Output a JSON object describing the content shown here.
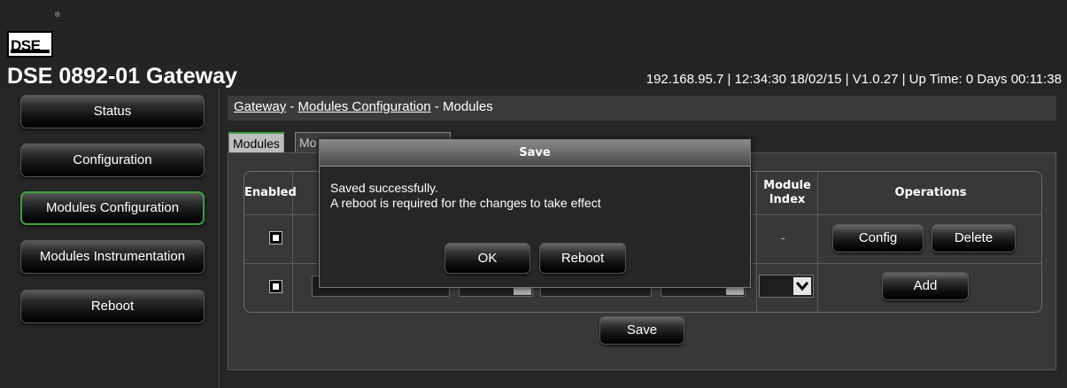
{
  "header": {
    "logo_text": "DSE",
    "logo_mark": "®",
    "title": "DSE 0892-01 Gateway",
    "status_line": "192.168.95.7 | 12:34:30 18/02/15 | V1.0.27 | Up Time: 0 Days 00:11:38"
  },
  "sidebar": {
    "items": [
      {
        "label": "Status"
      },
      {
        "label": "Configuration"
      },
      {
        "label": "Modules Configuration",
        "active": true
      },
      {
        "label": "Modules Instrumentation"
      },
      {
        "label": "Reboot"
      }
    ]
  },
  "breadcrumb": {
    "part1": "Gateway",
    "sep1": " - ",
    "part2": "Modules Configuration",
    "sep2": " - ",
    "part3": "Modules"
  },
  "tabs": [
    {
      "label": "Modules",
      "active": true
    },
    {
      "label": "Mo"
    }
  ],
  "table": {
    "headers": {
      "enabled": "Enabled",
      "module_index": "Module Index",
      "operations": "Operations"
    },
    "rows": [
      {
        "enabled": true,
        "module_index": "-",
        "buttons": [
          "Config",
          "Delete"
        ]
      },
      {
        "enabled": true,
        "module_index": "",
        "buttons": [
          "Add"
        ]
      }
    ]
  },
  "save_label": "Save",
  "modal": {
    "title": "Save",
    "line1": "Saved successfully.",
    "line2": "A reboot is required for the changes to take effect",
    "ok_label": "OK",
    "reboot_label": "Reboot"
  },
  "colors": {
    "accent_green": "#3aa23a",
    "background": "#242424"
  }
}
